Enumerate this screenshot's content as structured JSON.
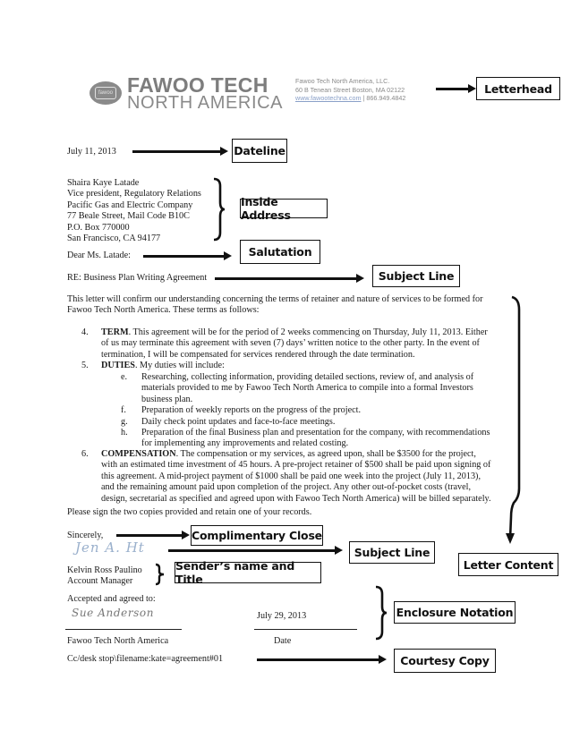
{
  "letterhead": {
    "company_line1": "FAWOO TECH",
    "company_line2": "NORTH AMERICA",
    "logo_badge_text": "fawoo",
    "info_line1": "Fawoo Tech North America, LLC.",
    "info_line2": "60 B Tenean Street Boston, MA 02122",
    "website": "www.fawootechna.com",
    "phone": "| 866.949.4842"
  },
  "letter": {
    "date": "July 11, 2013",
    "inside_address": [
      "Shaira Kaye Latade",
      "Vice president, Regulatory Relations",
      "Pacific Gas and Electric Company",
      "77 Beale Street, Mail Code B10C",
      "P.O. Box 770000",
      "San Francisco, CA 94177"
    ],
    "salutation": "Dear Ms. Latade:",
    "subject": "RE: Business Plan Writing Agreement",
    "intro_line1": "This letter will confirm our understanding concerning the terms of retainer and nature of services to be formed for",
    "intro_line2": "Fawoo Tech North America. These terms as follows:",
    "items": [
      {
        "number": "4.",
        "title": "TERM",
        "lines": [
          ". This agreement will be for the period of 2 weeks commencing on Thursday, July 11, 2013. Either",
          "of us may terminate this agreement with seven (7) days’ written notice to the other party. In the event of",
          "termination, I will be compensated for services rendered through the date termination."
        ]
      },
      {
        "number": "5.",
        "title": "DUTIES",
        "lines": [
          ". My duties will include:"
        ],
        "subitems": [
          {
            "letter": "e.",
            "lines": [
              "Researching, collecting information, providing detailed sections, review of, and analysis of",
              "materials provided to me by Fawoo Tech North America to compile into a formal Investors",
              "business plan."
            ]
          },
          {
            "letter": "f.",
            "lines": [
              "Preparation of weekly reports on the progress of the project."
            ]
          },
          {
            "letter": "g.",
            "lines": [
              "Daily check point updates and face-to-face meetings."
            ]
          },
          {
            "letter": "h.",
            "lines": [
              "Preparation of the final Business plan and presentation for the company, with recommendations",
              "for implementing any improvements and related costing."
            ]
          }
        ]
      },
      {
        "number": "6.",
        "title": "COMPENSATION",
        "lines": [
          ". The compensation or my services, as agreed upon, shall be $3500 for the project,",
          "with an estimated time investment of 45 hours. A pre-project retainer of $500 shall be paid upon signing of",
          "this agreement. A mid-project payment of $1000 shall be paid one week into the project (July 11, 2013),",
          "and the remaining amount paid upon completion of the project. Any other out-of-pocket costs (travel,",
          "design, secretarial as specified and agreed upon with Fawoo Tech North America) will be billed separately."
        ]
      }
    ],
    "closing_request": "Please sign the two copies provided and retain one of your records.",
    "complimentary_close": "Sincerely,",
    "sender_signature": "Jen A. Ht",
    "sender_name": "Kelvin Ross Paulino",
    "sender_title": "Account Manager",
    "accepted_label": "Accepted and agreed to:",
    "acceptor_signature": "Sue Anderson",
    "accept_date": "July 29, 2013",
    "acceptor_company": "Fawoo Tech North America",
    "date_label": "Date",
    "cc_line": "Cc/desk stop\\filename:kate=agreement#01"
  },
  "annotations": {
    "letterhead": "Letterhead",
    "dateline": "Dateline",
    "inside_address": "Inside Address",
    "salutation": "Salutation",
    "subject_line": "Subject Line",
    "letter_content": "Letter Content",
    "complimentary_close": "Complimentary Close",
    "subject_line_2": "Subject Line",
    "senders_name_title": "Sender’s name and Title",
    "enclosure_notation": "Enclosure Notation",
    "courtesy_copy": "Courtesy Copy"
  }
}
